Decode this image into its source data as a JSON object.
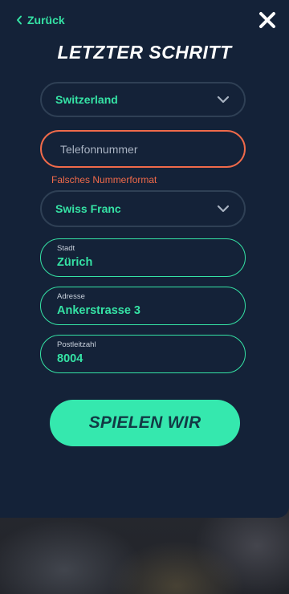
{
  "header": {
    "back_label": "Zurück",
    "title": "LETZTER SCHRITT"
  },
  "form": {
    "country": {
      "value": "Switzerland"
    },
    "phone": {
      "placeholder": "Telefonnummer",
      "value": "",
      "error": "Falsches Nummerformat"
    },
    "currency": {
      "value": "Swiss Franc"
    },
    "city": {
      "label": "Stadt",
      "value": "Zürich"
    },
    "address": {
      "label": "Adresse",
      "value": "Ankerstrasse 3"
    },
    "zip": {
      "label": "Postleitzahl",
      "value": "8004"
    },
    "submit_label": "SPIELEN WIR"
  },
  "colors": {
    "modal_bg": "#142238",
    "accent": "#35e3a5",
    "error": "#f06a4a",
    "button_bg": "#35e8ae",
    "button_text": "#123a45"
  },
  "icons": {
    "back": "chevron-left-icon",
    "close": "close-icon",
    "dropdown": "chevron-down-icon"
  }
}
